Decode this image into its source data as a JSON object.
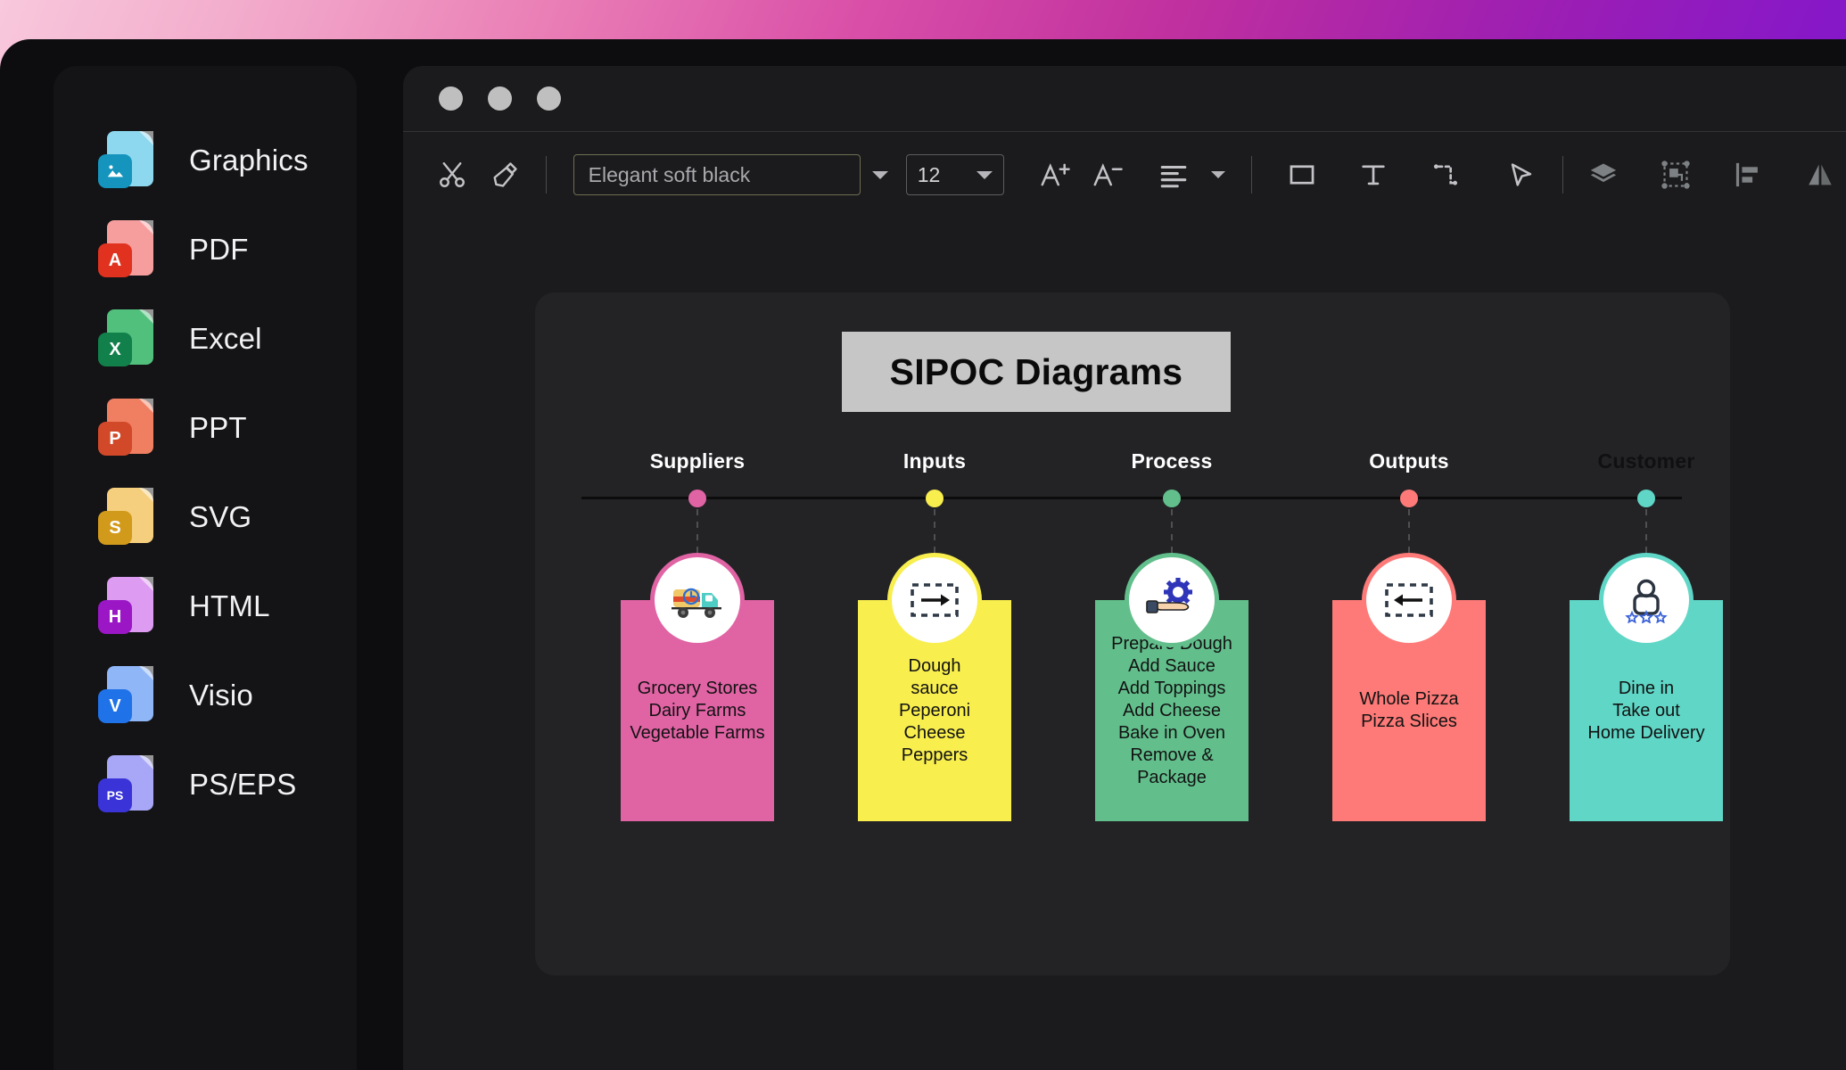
{
  "sidebar": {
    "items": [
      {
        "label": "Graphics",
        "icon": "graphics-file-icon",
        "badge": "",
        "sheet_color": "#8ed8ef",
        "badge_color": "#1595bd"
      },
      {
        "label": "PDF",
        "icon": "pdf-file-icon",
        "badge": "A",
        "sheet_color": "#f69e9e",
        "badge_color": "#e0321f"
      },
      {
        "label": "Excel",
        "icon": "excel-file-icon",
        "badge": "X",
        "sheet_color": "#52c07d",
        "badge_color": "#11804a"
      },
      {
        "label": "PPT",
        "icon": "ppt-file-icon",
        "badge": "P",
        "sheet_color": "#f07f62",
        "badge_color": "#d2492a"
      },
      {
        "label": "SVG",
        "icon": "svg-file-icon",
        "badge": "S",
        "sheet_color": "#f5cf7d",
        "badge_color": "#d29a1b"
      },
      {
        "label": "HTML",
        "icon": "html-file-icon",
        "badge": "H",
        "sheet_color": "#dd9bf2",
        "badge_color": "#9b17c6"
      },
      {
        "label": "Visio",
        "icon": "visio-file-icon",
        "badge": "V",
        "sheet_color": "#8fb6f7",
        "badge_color": "#1f72e8"
      },
      {
        "label": "PS/EPS",
        "icon": "ps-eps-file-icon",
        "badge": "PS",
        "sheet_color": "#a8a7f7",
        "badge_color": "#3a34d8"
      }
    ]
  },
  "window": {
    "traffic_lights": [
      "close-button",
      "minimize-button",
      "maximize-button"
    ]
  },
  "toolbar": {
    "cut_label": "cut-icon",
    "format_painter_label": "format-painter-icon",
    "font_name": "Elegant soft black",
    "font_name_placeholder": "Elegant soft black",
    "font_size": "12",
    "increase_font_label": "increase-font-size-icon",
    "decrease_font_label": "decrease-font-size-icon",
    "align_label": "align-text-icon",
    "shape_label": "rectangle-shape-icon",
    "text_label": "text-tool-icon",
    "connector_label": "connector-line-icon",
    "select_label": "select-pointer-icon",
    "layers_label": "layers-icon",
    "group_label": "group-objects-icon",
    "align_objects_label": "align-left-icon",
    "flip_label": "flip-horizontal-icon"
  },
  "chart_data": {
    "type": "diagram",
    "title": "SIPOC Diagrams",
    "columns": [
      {
        "header": "Suppliers",
        "header_color": "#ffffff",
        "color": "#e063a4",
        "node_color": "#e063a4",
        "icon": "delivery-truck-icon",
        "items": [
          "Grocery Stores",
          "Dairy Farms",
          "Vegetable Farms"
        ]
      },
      {
        "header": "Inputs",
        "header_color": "#ffffff",
        "color": "#f8ee4e",
        "node_color": "#f8ee4e",
        "icon": "input-arrow-icon",
        "items": [
          "Dough",
          "sauce",
          "Peperoni",
          "Cheese",
          "Peppers"
        ]
      },
      {
        "header": "Process",
        "header_color": "#ffffff",
        "color": "#62bf8c",
        "node_color": "#62bf8c",
        "icon": "hand-gear-icon",
        "items": [
          "Prepare Dough",
          "Add Sauce",
          "Add Toppings",
          "Add Cheese",
          "Bake in Oven",
          "Remove & Package"
        ]
      },
      {
        "header": "Outputs",
        "header_color": "#ffffff",
        "color": "#fd7a78",
        "node_color": "#fd7a78",
        "icon": "output-arrow-icon",
        "items": [
          "Whole Pizza",
          "Pizza Slices"
        ]
      },
      {
        "header": "Customer",
        "header_color": "#101012",
        "color": "#5fd6c6",
        "node_color": "#5fd6c6",
        "icon": "customer-rating-icon",
        "items": [
          "Dine in",
          "Take out",
          "Home Delivery"
        ]
      }
    ]
  }
}
